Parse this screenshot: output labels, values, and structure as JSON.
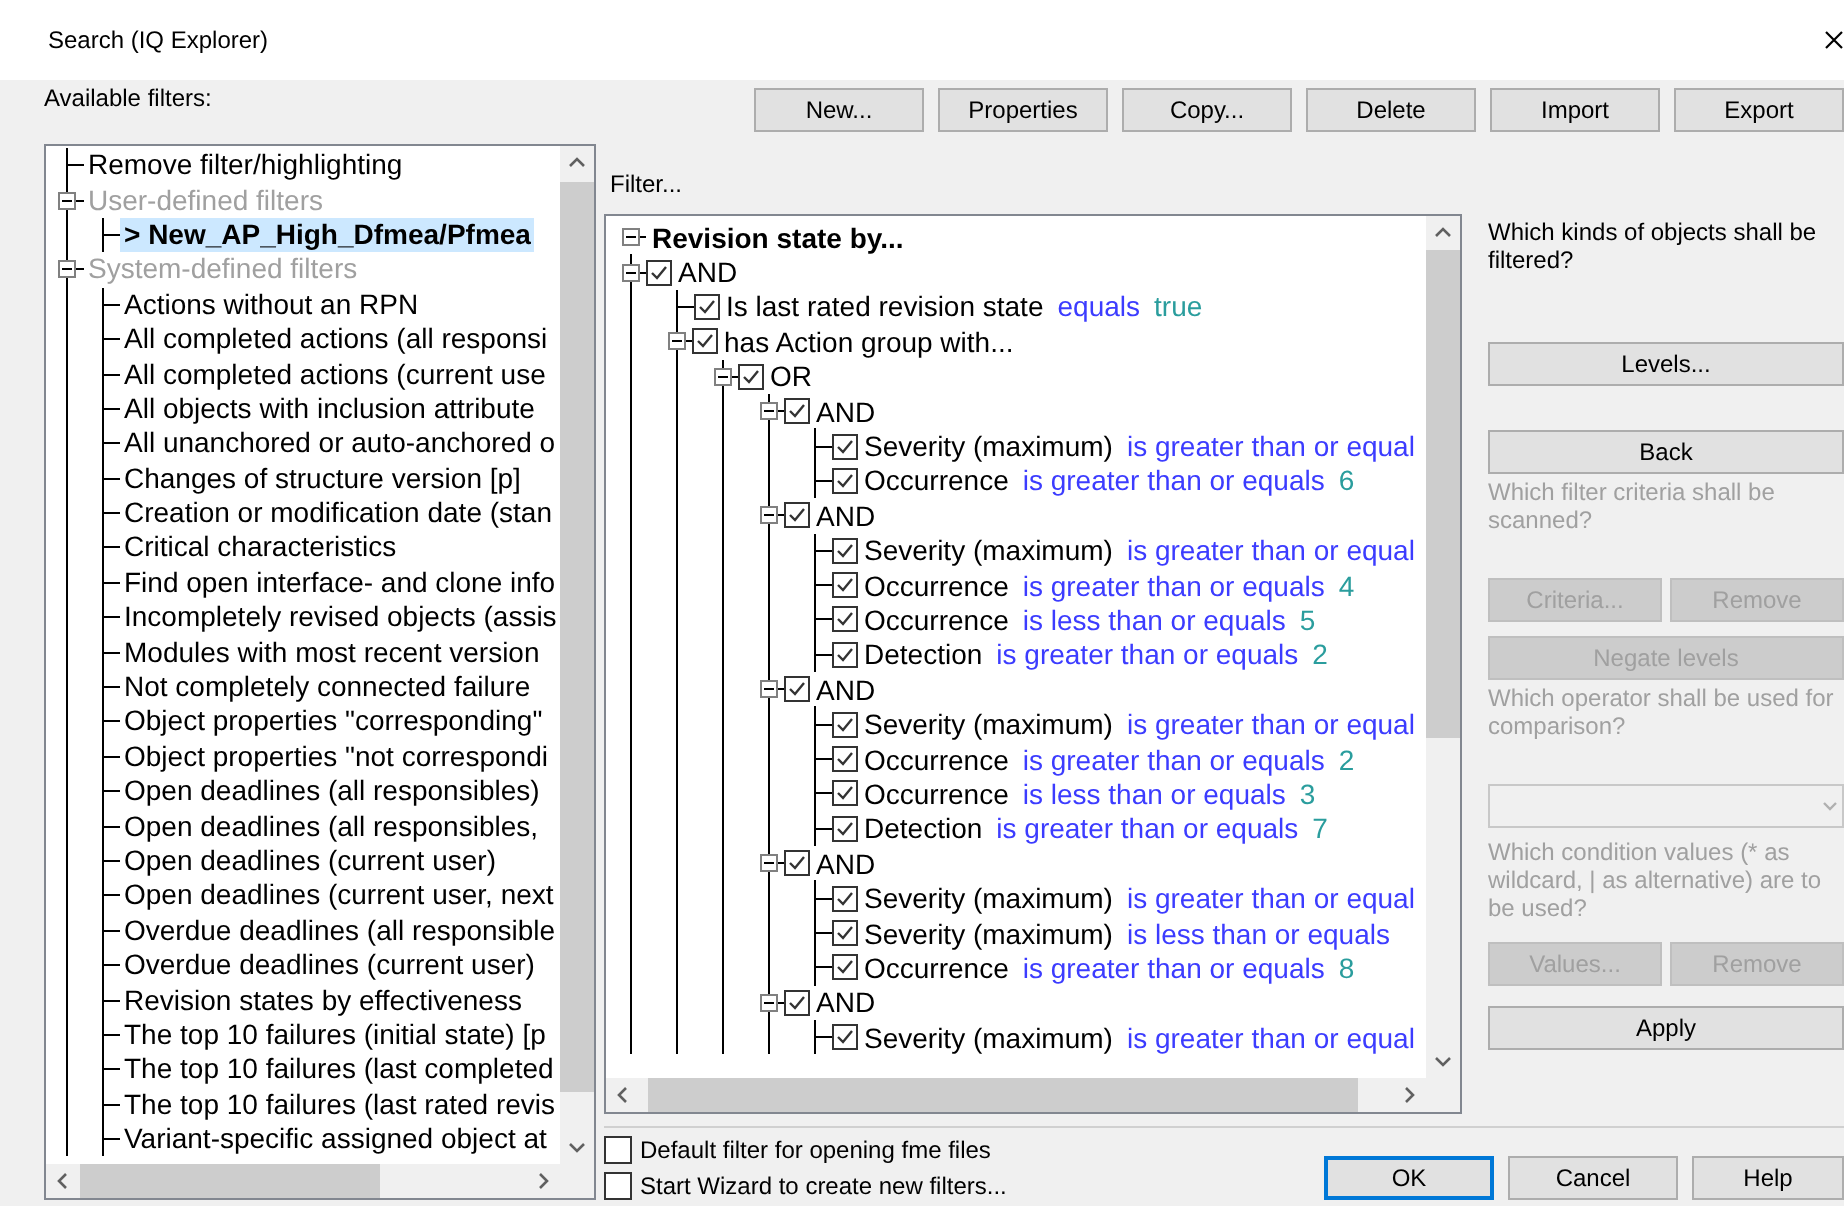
{
  "window": {
    "title": "Search (IQ Explorer)"
  },
  "available_filters": {
    "label": "Available filters:",
    "items": [
      {
        "kind": "leaf",
        "label": "Remove filter/highlighting",
        "selected": false
      },
      {
        "kind": "category",
        "label": "User-defined filters",
        "expanded": true,
        "selected": false,
        "children": [
          {
            "kind": "leaf",
            "label": "> New_AP_High_Dfmea/Pfmea",
            "selected": true
          }
        ]
      },
      {
        "kind": "category",
        "label": "System-defined filters",
        "expanded": true,
        "selected": false,
        "children": [
          {
            "kind": "leaf",
            "label": "Actions without an RPN",
            "selected": false
          },
          {
            "kind": "leaf",
            "label": "All completed actions (all responsi",
            "selected": false
          },
          {
            "kind": "leaf",
            "label": "All completed actions (current use",
            "selected": false
          },
          {
            "kind": "leaf",
            "label": "All objects with inclusion attribute",
            "selected": false
          },
          {
            "kind": "leaf",
            "label": "All unanchored or auto-anchored o",
            "selected": false
          },
          {
            "kind": "leaf",
            "label": "Changes of structure version [p]",
            "selected": false
          },
          {
            "kind": "leaf",
            "label": "Creation or modification date (stan",
            "selected": false
          },
          {
            "kind": "leaf",
            "label": "Critical characteristics",
            "selected": false
          },
          {
            "kind": "leaf",
            "label": "Find open interface- and clone info",
            "selected": false
          },
          {
            "kind": "leaf",
            "label": "Incompletely revised objects (assis",
            "selected": false
          },
          {
            "kind": "leaf",
            "label": "Modules with most recent version",
            "selected": false
          },
          {
            "kind": "leaf",
            "label": "Not completely connected failure",
            "selected": false
          },
          {
            "kind": "leaf",
            "label": "Object properties \"corresponding\"",
            "selected": false
          },
          {
            "kind": "leaf",
            "label": "Object properties \"not correspondi",
            "selected": false
          },
          {
            "kind": "leaf",
            "label": "Open deadlines (all responsibles)",
            "selected": false
          },
          {
            "kind": "leaf",
            "label": "Open deadlines (all responsibles,",
            "selected": false
          },
          {
            "kind": "leaf",
            "label": "Open deadlines (current user)",
            "selected": false
          },
          {
            "kind": "leaf",
            "label": "Open deadlines (current user, next",
            "selected": false
          },
          {
            "kind": "leaf",
            "label": "Overdue deadlines (all responsible",
            "selected": false
          },
          {
            "kind": "leaf",
            "label": "Overdue deadlines (current user)",
            "selected": false
          },
          {
            "kind": "leaf",
            "label": "Revision states by effectiveness",
            "selected": false
          },
          {
            "kind": "leaf",
            "label": "The top 10 failures (initial state) [p",
            "selected": false
          },
          {
            "kind": "leaf",
            "label": "The top 10 failures (last completed",
            "selected": false
          },
          {
            "kind": "leaf",
            "label": "The top 10 failures (last rated revis",
            "selected": false
          },
          {
            "kind": "leaf",
            "label": "Variant-specific assigned object at",
            "selected": false
          }
        ]
      }
    ]
  },
  "toolbar": {
    "buttons": [
      {
        "label": "New..."
      },
      {
        "label": "Properties"
      },
      {
        "label": "Copy..."
      },
      {
        "label": "Delete"
      },
      {
        "label": "Import"
      },
      {
        "label": "Export"
      }
    ]
  },
  "filter": {
    "label": "Filter...",
    "tree": {
      "kind": "root",
      "label": "Revision state by...",
      "expanded": true,
      "children": [
        {
          "kind": "group",
          "label": "AND",
          "checked": true,
          "expanded": true,
          "children": [
            {
              "kind": "condition",
              "field": "Is last rated revision state",
              "operator": "equals",
              "value": "true",
              "checked": true
            },
            {
              "kind": "group",
              "label": "has Action group with...",
              "checked": true,
              "expanded": true,
              "children": [
                {
                  "kind": "group",
                  "label": "OR",
                  "checked": true,
                  "expanded": true,
                  "children": [
                    {
                      "kind": "group",
                      "label": "AND",
                      "checked": true,
                      "expanded": true,
                      "children": [
                        {
                          "kind": "condition",
                          "field": "Severity (maximum)",
                          "operator": "is greater than or equal",
                          "checked": true
                        },
                        {
                          "kind": "condition",
                          "field": "Occurrence",
                          "operator": "is greater than or equals",
                          "value": "6",
                          "checked": true
                        }
                      ]
                    },
                    {
                      "kind": "group",
                      "label": "AND",
                      "checked": true,
                      "expanded": true,
                      "children": [
                        {
                          "kind": "condition",
                          "field": "Severity (maximum)",
                          "operator": "is greater than or equal",
                          "checked": true
                        },
                        {
                          "kind": "condition",
                          "field": "Occurrence",
                          "operator": "is greater than or equals",
                          "value": "4",
                          "checked": true
                        },
                        {
                          "kind": "condition",
                          "field": "Occurrence",
                          "operator": "is less than or equals",
                          "value": "5",
                          "checked": true
                        },
                        {
                          "kind": "condition",
                          "field": "Detection",
                          "operator": "is greater than or equals",
                          "value": "2",
                          "checked": true
                        }
                      ]
                    },
                    {
                      "kind": "group",
                      "label": "AND",
                      "checked": true,
                      "expanded": true,
                      "children": [
                        {
                          "kind": "condition",
                          "field": "Severity (maximum)",
                          "operator": "is greater than or equal",
                          "checked": true
                        },
                        {
                          "kind": "condition",
                          "field": "Occurrence",
                          "operator": "is greater than or equals",
                          "value": "2",
                          "checked": true
                        },
                        {
                          "kind": "condition",
                          "field": "Occurrence",
                          "operator": "is less than or equals",
                          "value": "3",
                          "checked": true
                        },
                        {
                          "kind": "condition",
                          "field": "Detection",
                          "operator": "is greater than or equals",
                          "value": "7",
                          "checked": true
                        }
                      ]
                    },
                    {
                      "kind": "group",
                      "label": "AND",
                      "checked": true,
                      "expanded": true,
                      "children": [
                        {
                          "kind": "condition",
                          "field": "Severity (maximum)",
                          "operator": "is greater than or equal",
                          "checked": true
                        },
                        {
                          "kind": "condition",
                          "field": "Severity (maximum)",
                          "operator": "is less than or equals",
                          "checked": true
                        },
                        {
                          "kind": "condition",
                          "field": "Occurrence",
                          "operator": "is greater than or equals",
                          "value": "8",
                          "checked": true
                        }
                      ]
                    },
                    {
                      "kind": "group",
                      "label": "AND",
                      "checked": true,
                      "expanded": true,
                      "children": [
                        {
                          "kind": "condition",
                          "field": "Severity (maximum)",
                          "operator": "is greater than or equal",
                          "checked": true
                        }
                      ]
                    }
                  ]
                }
              ]
            }
          ]
        }
      ]
    }
  },
  "side_panel": {
    "items": [
      {
        "kind": "hint",
        "text": "Which kinds of objects shall be filtered?",
        "disabled": false
      },
      {
        "kind": "button",
        "label": "Levels...",
        "disabled": false
      },
      {
        "kind": "button",
        "label": "Back",
        "disabled": false
      },
      {
        "kind": "hint",
        "text": "Which filter criteria shall be scanned?",
        "disabled": true
      },
      {
        "kind": "button_row",
        "buttons": [
          {
            "label": "Criteria...",
            "disabled": true
          },
          {
            "label": "Remove",
            "disabled": true
          }
        ]
      },
      {
        "kind": "button",
        "label": "Negate levels",
        "disabled": true
      },
      {
        "kind": "hint",
        "text": "Which operator shall be used for comparison?",
        "disabled": true
      },
      {
        "kind": "dropdown",
        "disabled": true
      },
      {
        "kind": "hint",
        "text": "Which condition values (* as wildcard, | as alternative) are to be used?",
        "disabled": true
      },
      {
        "kind": "button_row",
        "buttons": [
          {
            "label": "Values...",
            "disabled": true
          },
          {
            "label": "Remove",
            "disabled": true
          }
        ]
      },
      {
        "kind": "button",
        "label": "Apply",
        "disabled": false
      }
    ]
  },
  "options": [
    {
      "label": "Default filter for opening fme files",
      "checked": false
    },
    {
      "label": "Start Wizard to create new filters...",
      "checked": false
    }
  ],
  "dialog_buttons": [
    {
      "label": "OK",
      "default": true
    },
    {
      "label": "Cancel",
      "default": false
    },
    {
      "label": "Help",
      "default": false
    }
  ]
}
